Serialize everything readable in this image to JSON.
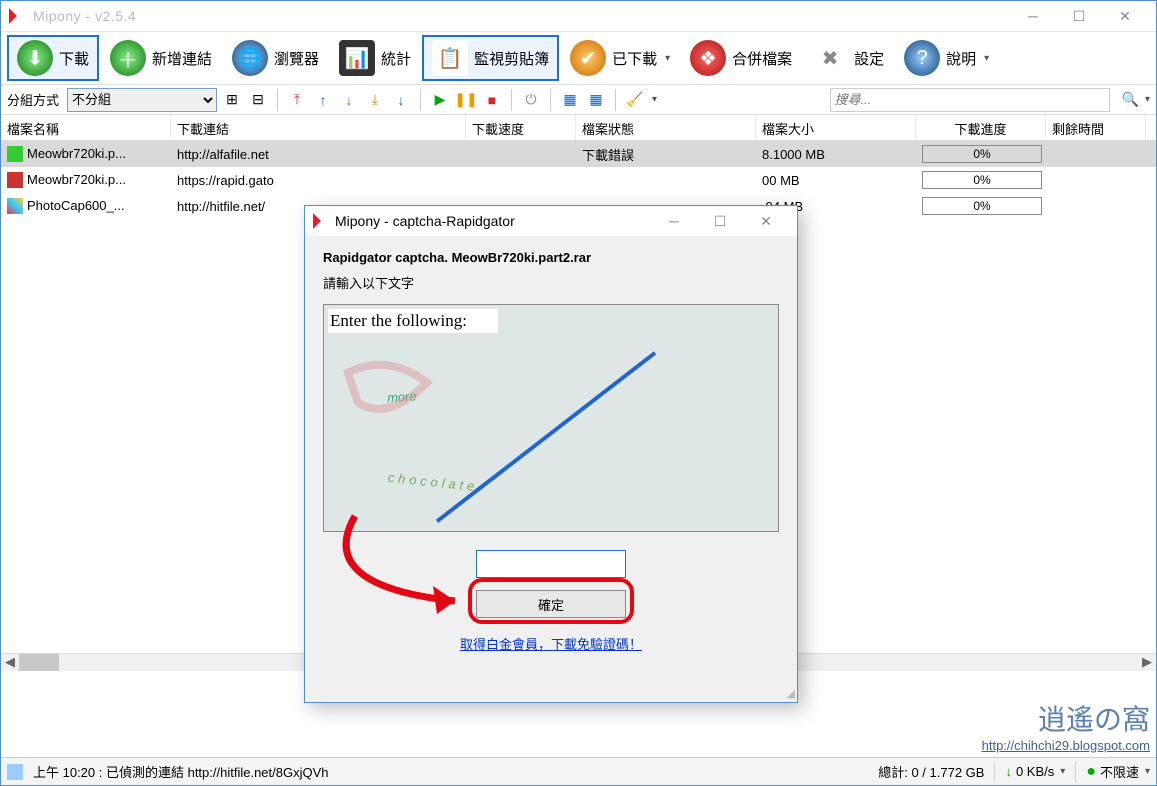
{
  "window": {
    "title": "Mipony - v2.5.4"
  },
  "toolbar": {
    "download": "下載",
    "addlink": "新增連結",
    "browser": "瀏覽器",
    "stats": "統計",
    "clipboard": "監視剪貼簿",
    "downloaded": "已下載",
    "merge": "合併檔案",
    "settings": "設定",
    "help": "說明"
  },
  "subbar": {
    "grouplabel": "分組方式",
    "groupvalue": "不分組",
    "search_ph": "搜尋..."
  },
  "columns": {
    "name": "檔案名稱",
    "link": "下載連結",
    "speed": "下載速度",
    "status": "檔案狀態",
    "size": "檔案大小",
    "progress": "下載進度",
    "remain": "剩餘時間"
  },
  "rows": [
    {
      "name": "Meowbr720ki.p...",
      "link": "http://alfafile.net",
      "status": "下載錯誤",
      "size": "8.1000 MB",
      "progress": "0%",
      "icon_color": "#3c3"
    },
    {
      "name": "Meowbr720ki.p...",
      "link": "https://rapid.gato",
      "status": "",
      "size": "00 MB",
      "progress": "0%",
      "icon_color": "#c33"
    },
    {
      "name": "PhotoCap600_...",
      "link": "http://hitfile.net/",
      "status": "",
      "size": ".94 MB",
      "progress": "0%",
      "icon_color": "#39c"
    }
  ],
  "dialog": {
    "title": "Mipony - captcha-Rapidgator",
    "line1": "Rapidgator captcha. MeowBr720ki.part2.rar",
    "line2": "請輸入以下文字",
    "enter": "Enter the following:",
    "captcha_word1": "more",
    "captcha_word2": "chocolate",
    "ok": "確定",
    "premium": "取得白金會員，下載免驗證碼！"
  },
  "statusbar": {
    "time": "上午 10:20 : 已偵測的連結 http://hitfile.net/8GxjQVh",
    "total": "總計: 0 / 1.772 GB",
    "speed": "0 KB/s",
    "limit": "不限速"
  },
  "watermark": {
    "l1": "逍遙の窩",
    "l2": "http://chihchi29.blogspot.com"
  }
}
